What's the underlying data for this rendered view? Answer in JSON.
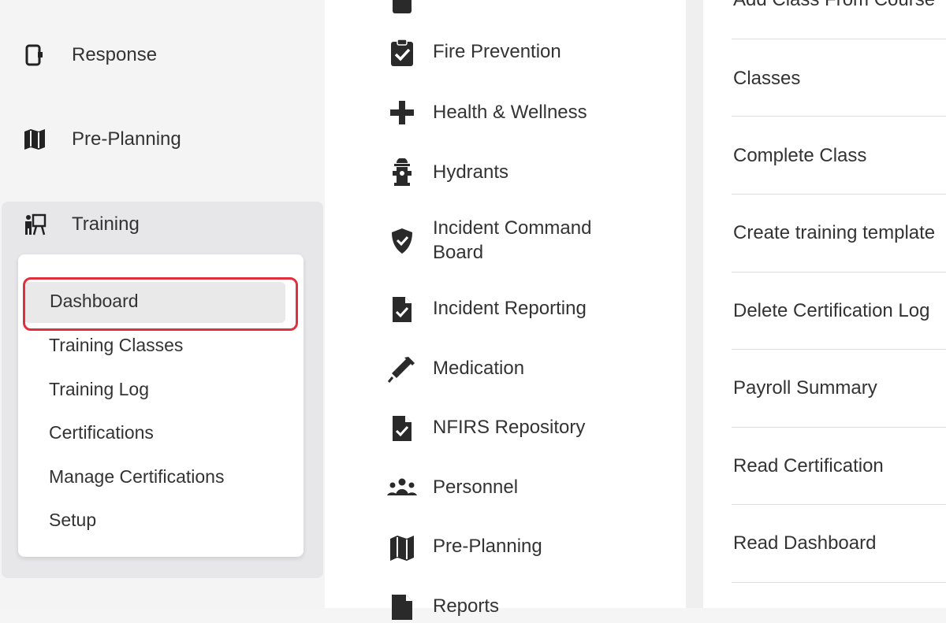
{
  "sidebar": {
    "items": [
      {
        "label": "Response",
        "icon": "phone-radio-icon"
      },
      {
        "label": "Pre-Planning",
        "icon": "map-icon"
      },
      {
        "label": "Training",
        "icon": "training-icon"
      }
    ],
    "training_submenu": [
      "Dashboard",
      "Training Classes",
      "Training Log",
      "Certifications",
      "Manage Certifications",
      "Setup"
    ]
  },
  "modules": [
    {
      "label": "Fire Prevention",
      "icon": "clipboard-check-icon"
    },
    {
      "label": "Health & Wellness",
      "icon": "plus-icon"
    },
    {
      "label": "Hydrants",
      "icon": "hydrant-icon"
    },
    {
      "label": "Incident Command Board",
      "icon": "shield-icon"
    },
    {
      "label": "Incident Reporting",
      "icon": "file-check-icon"
    },
    {
      "label": "Medication",
      "icon": "syringe-icon"
    },
    {
      "label": "NFIRS Repository",
      "icon": "file-check-icon"
    },
    {
      "label": "Personnel",
      "icon": "people-icon"
    },
    {
      "label": "Pre-Planning",
      "icon": "map-icon"
    },
    {
      "label": "Reports",
      "icon": "report-icon"
    }
  ],
  "permissions": [
    "Add Class From Course",
    "Classes",
    "Complete Class",
    "Create training template",
    "Delete Certification Log",
    "Payroll Summary",
    "Read Certification",
    "Read Dashboard"
  ],
  "colors": {
    "highlight": "#e0303d",
    "text": "#333333"
  }
}
